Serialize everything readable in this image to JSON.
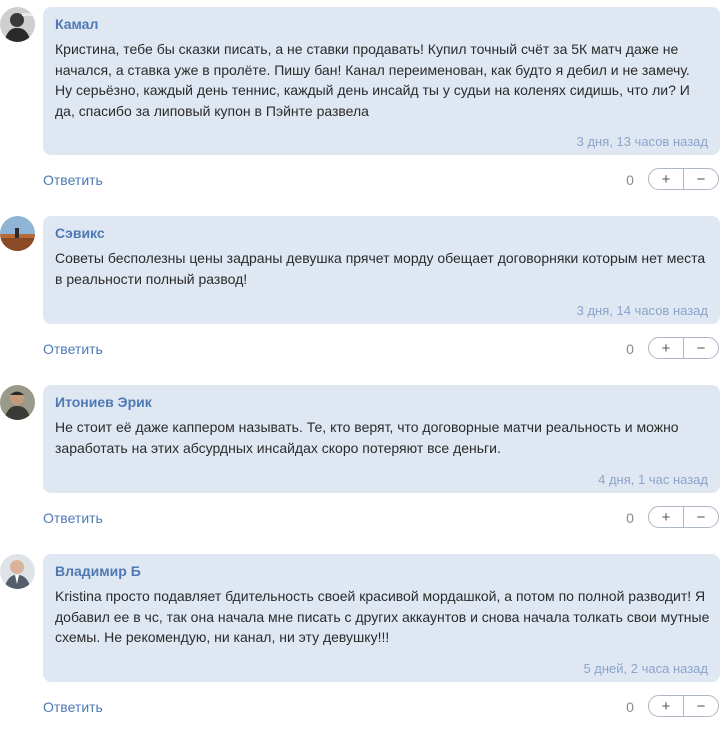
{
  "ui": {
    "reply_label": "Ответить",
    "plus_label": "+",
    "minus_label": "−"
  },
  "comments": [
    {
      "author": "Камал",
      "text": "Кристина, тебе бы сказки писать, а не ставки продавать! Купил точный счёт за 5К матч даже не начался, а ставка уже в пролёте. Пишу бан! Канал переименован, как будто я дебил и не замечу. Ну серьёзно, каждый день теннис, каждый день инсайд ты у судьи на коленях сидишь, что ли? И да, спасибо за липовый купон в Пэйнте развела",
      "time": "3 дня, 13 часов назад",
      "score": "0"
    },
    {
      "author": "Сэвикс",
      "text": "Советы бесполезны цены задраны девушка прячет морду обещает договорняки которым нет места в реальности полный развод!",
      "time": "3 дня, 14 часов назад",
      "score": "0"
    },
    {
      "author": "Итониев Эрик",
      "text": "Не стоит её даже каппером называть. Те, кто верят, что договорные матчи реальность и можно заработать на этих абсурдных инсайдах скоро потеряют все деньги.",
      "time": "4 дня, 1 час назад",
      "score": "0"
    },
    {
      "author": "Владимир Б",
      "text": "Kristina просто подавляет бдительность своей красивой мордашкой, а потом по полной разводит! Я добавил ее в чс, так она начала мне писать с других аккаунтов и снова начала толкать свои мутные схемы. Не рекомендую, ни канал, ни эту девушку!!!",
      "time": "5 дней, 2 часа назад",
      "score": "0"
    }
  ]
}
